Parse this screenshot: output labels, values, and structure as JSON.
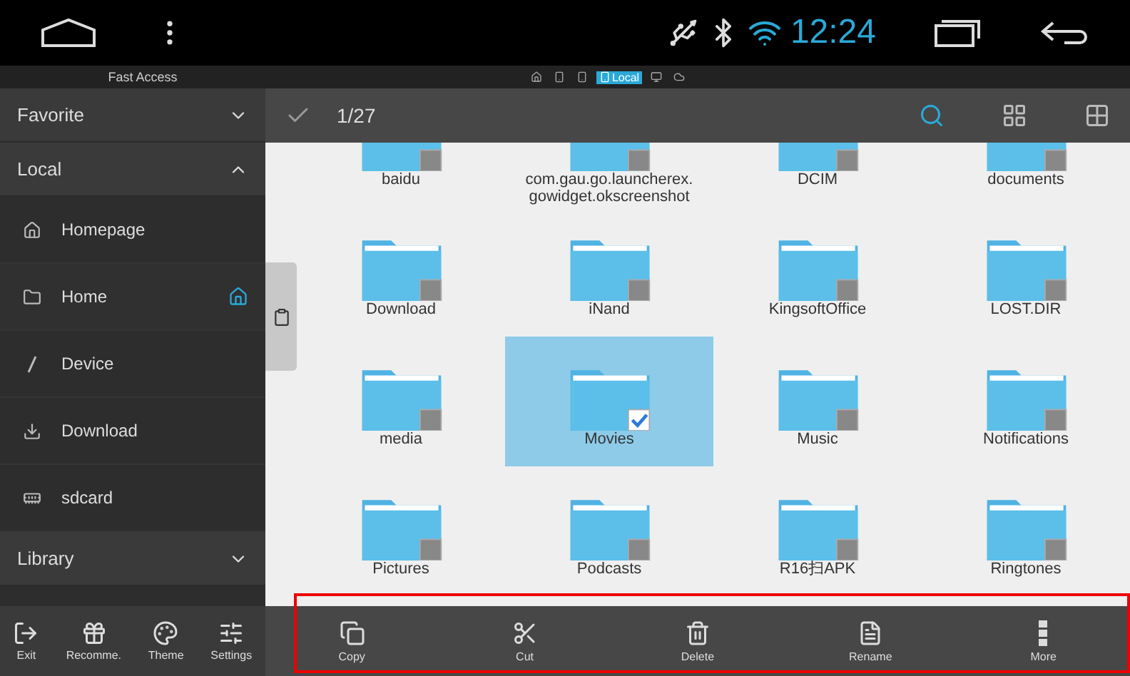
{
  "status_bar": {
    "time": "12:24"
  },
  "breadcrumb": {
    "label": "Fast Access",
    "path": [
      {
        "kind": "home",
        "selected": false
      },
      {
        "kind": "phone",
        "selected": false
      },
      {
        "kind": "phone",
        "selected": false
      },
      {
        "kind": "phone",
        "label": "Local",
        "selected": true
      },
      {
        "kind": "pc",
        "selected": false
      },
      {
        "kind": "cloud",
        "selected": false
      }
    ]
  },
  "sidebar": {
    "sections": [
      {
        "title": "Favorite",
        "expanded": false
      },
      {
        "title": "Local",
        "expanded": true
      }
    ],
    "items": [
      {
        "kind": "homepage",
        "label": "Homepage",
        "selected": false
      },
      {
        "kind": "home",
        "label": "Home",
        "selected": true
      },
      {
        "kind": "device",
        "label": "Device",
        "selected": false
      },
      {
        "kind": "download",
        "label": "Download",
        "selected": false
      },
      {
        "kind": "sdcard",
        "label": "sdcard",
        "selected": false
      }
    ],
    "library": {
      "title": "Library",
      "expanded": false
    },
    "tools": [
      {
        "kind": "exit",
        "label": "Exit"
      },
      {
        "kind": "gift",
        "label": "Recomme."
      },
      {
        "kind": "theme",
        "label": "Theme"
      },
      {
        "kind": "settings",
        "label": "Settings"
      }
    ]
  },
  "toolbar": {
    "count": "1/27"
  },
  "folders": [
    {
      "name": "baidu",
      "selected": false
    },
    {
      "name": "com.gau.go.launcherex.\ngowidget.okscreenshot",
      "selected": false
    },
    {
      "name": "DCIM",
      "selected": false
    },
    {
      "name": "documents",
      "selected": false
    },
    {
      "name": "Download",
      "selected": false
    },
    {
      "name": "iNand",
      "selected": false
    },
    {
      "name": "KingsoftOffice",
      "selected": false
    },
    {
      "name": "LOST.DIR",
      "selected": false
    },
    {
      "name": "media",
      "selected": false
    },
    {
      "name": "Movies",
      "selected": true
    },
    {
      "name": "Music",
      "selected": false
    },
    {
      "name": "Notifications",
      "selected": false
    },
    {
      "name": "Pictures",
      "selected": false
    },
    {
      "name": "Podcasts",
      "selected": false
    },
    {
      "name": "R16扫APK",
      "selected": false
    },
    {
      "name": "Ringtones",
      "selected": false
    }
  ],
  "actions": [
    {
      "kind": "copy",
      "label": "Copy"
    },
    {
      "kind": "cut",
      "label": "Cut"
    },
    {
      "kind": "delete",
      "label": "Delete"
    },
    {
      "kind": "rename",
      "label": "Rename"
    },
    {
      "kind": "more",
      "label": "More"
    }
  ]
}
